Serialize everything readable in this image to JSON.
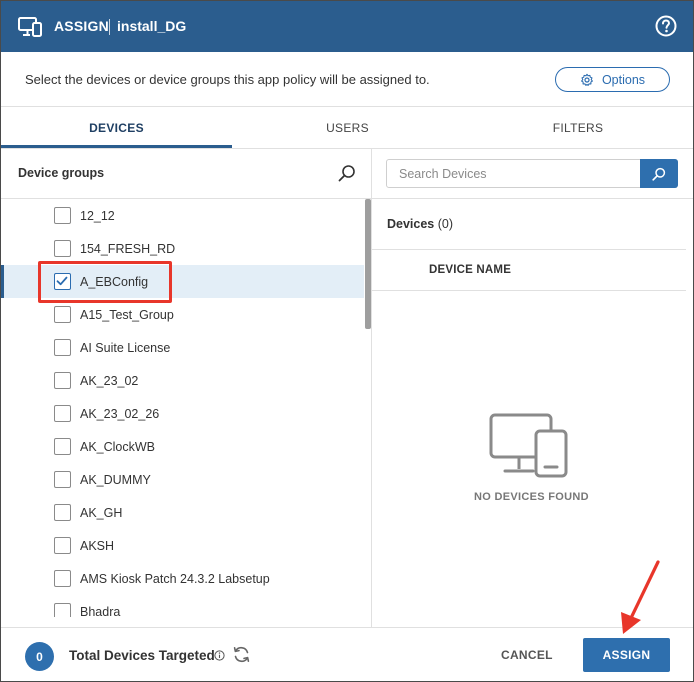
{
  "header": {
    "title": "ASSIGN",
    "subtitle": "install_DG",
    "app_icon": "devices-icon",
    "help_icon": "help-icon"
  },
  "description": "Select the devices or device groups this app policy will be assigned to.",
  "options_button": {
    "label": "Options",
    "icon": "gear-icon"
  },
  "tabs": [
    {
      "label": "DEVICES",
      "active": true
    },
    {
      "label": "USERS",
      "active": false
    },
    {
      "label": "FILTERS",
      "active": false
    }
  ],
  "device_groups": {
    "title": "Device groups",
    "items": [
      {
        "label": "12_12",
        "checked": false
      },
      {
        "label": "154_FRESH_RD",
        "checked": false
      },
      {
        "label": "A_EBConfig",
        "checked": true
      },
      {
        "label": "A15_Test_Group",
        "checked": false
      },
      {
        "label": "AI Suite License",
        "checked": false
      },
      {
        "label": "AK_23_02",
        "checked": false
      },
      {
        "label": "AK_23_02_26",
        "checked": false
      },
      {
        "label": "AK_ClockWB",
        "checked": false
      },
      {
        "label": "AK_DUMMY",
        "checked": false
      },
      {
        "label": "AK_GH",
        "checked": false
      },
      {
        "label": "AKSH",
        "checked": false
      },
      {
        "label": "AMS Kiosk Patch 24.3.2 Labsetup",
        "checked": false
      },
      {
        "label": "Bhadra",
        "checked": false
      }
    ]
  },
  "devices_panel": {
    "search_placeholder": "Search Devices",
    "label": "Devices",
    "count": "(0)",
    "column": "DEVICE NAME",
    "empty_text": "NO DEVICES FOUND"
  },
  "footer": {
    "count": "0",
    "total_label": "Total Devices Targeted",
    "cancel_label": "CANCEL",
    "assign_label": "ASSIGN"
  },
  "colors": {
    "header": "#2b5d8e",
    "accent": "#2e6fae",
    "highlight": "#e8362a"
  }
}
